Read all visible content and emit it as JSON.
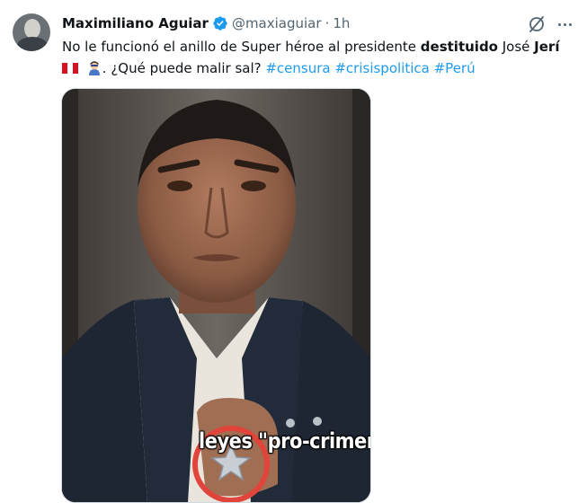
{
  "author": {
    "name": "Maximiliano Aguiar",
    "handle": "@maxiaguiar",
    "separator": "·",
    "time": "1h"
  },
  "tweet": {
    "part1": "No le funcionó el anillo de Super héroe al presidente ",
    "bold1": "destituido",
    "part2": " José ",
    "bold2": "Jerí",
    "part3": ". ¿Qué puede malir sal? ",
    "hashtags": [
      "#censura",
      "#crisispolitica",
      "#Perú"
    ]
  },
  "media": {
    "caption": "leyes \"pro-crimen\".",
    "highlight_color": "#e0443a"
  },
  "icons": {
    "verified": "verified-badge-icon",
    "grok": "grok-icon",
    "more": "more-icon",
    "flag": "peru-flag-icon",
    "hero": "superhero-emoji-icon"
  },
  "colors": {
    "accent": "#1d9bf0",
    "text": "#0f1419",
    "secondary": "#536471"
  }
}
